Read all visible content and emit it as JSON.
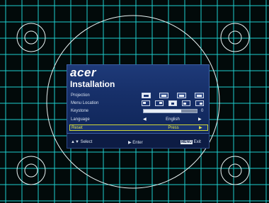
{
  "osd": {
    "brand": "acer",
    "title": "Installation",
    "items": [
      {
        "label": "Projection"
      },
      {
        "label": "Menu Location"
      },
      {
        "label": "Keystone",
        "value": "0",
        "level": 0.71
      },
      {
        "label": "Language",
        "value": "English"
      },
      {
        "label": "Reset",
        "value": "Press",
        "selected": true
      }
    ],
    "footer": {
      "select": "Select",
      "enter": "Enter",
      "menu_key": "MENU",
      "exit": "Exit"
    }
  },
  "colors": {
    "grid": "#1ecfcf",
    "circle": "#e8f2f2",
    "osd_bg": "#17306a",
    "highlight": "#e6e847"
  }
}
